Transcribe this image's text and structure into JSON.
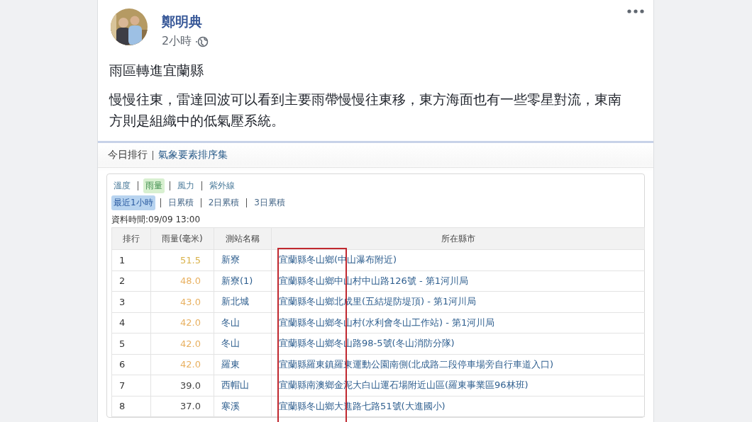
{
  "post": {
    "author": "鄭明典",
    "time": "2小時",
    "title": "雨區轉進宜蘭縣",
    "body": "慢慢往東，雷達回波可以看到主要雨帶慢慢往東移，東方海面也有一些零星對流，東南方則是組織中的低氣壓系統。"
  },
  "embed": {
    "header": [
      "今日排行",
      "氣象要素排序集"
    ],
    "tabs": [
      {
        "label": "溫度",
        "selected": false
      },
      {
        "label": "雨量",
        "selected": true
      },
      {
        "label": "風力",
        "selected": false
      },
      {
        "label": "紫外線",
        "selected": false
      }
    ],
    "periods": [
      {
        "label": "最近1小時",
        "selected": true
      },
      {
        "label": "日累積",
        "selected": false
      },
      {
        "label": "2日累積",
        "selected": false
      },
      {
        "label": "3日累積",
        "selected": false
      }
    ],
    "data_time": "資料時間:09/09 13:00",
    "table": {
      "highlight_box": true,
      "columns": [
        "排行",
        "雨量(毫米)",
        "測站名稱",
        "所在縣市"
      ],
      "rows": [
        {
          "rank": "1",
          "rain": "51.5",
          "color": "#d9b24a",
          "station": "新寮",
          "location": "宜蘭縣冬山鄉(中山瀑布附近)"
        },
        {
          "rank": "2",
          "rain": "48.0",
          "color": "#e8b060",
          "station": "新寮(1)",
          "location": "宜蘭縣冬山鄉中山村中山路126號 - 第1河川局"
        },
        {
          "rank": "3",
          "rain": "43.0",
          "color": "#e8b060",
          "station": "新北城",
          "location": "宜蘭縣冬山鄉北成里(五結堤防堤頂) - 第1河川局"
        },
        {
          "rank": "4",
          "rain": "42.0",
          "color": "#e8b060",
          "station": "冬山",
          "location": "宜蘭縣冬山鄉冬山村(水利會冬山工作站) - 第1河川局"
        },
        {
          "rank": "5",
          "rain": "42.0",
          "color": "#e8b060",
          "station": "冬山",
          "location": "宜蘭縣冬山鄉冬山路98-5號(冬山消防分隊)"
        },
        {
          "rank": "6",
          "rain": "42.0",
          "color": "#e8b060",
          "station": "羅東",
          "location": "宜蘭縣羅東鎮羅東運動公園南側(北成路二段停車場旁自行車道入口)"
        },
        {
          "rank": "7",
          "rain": "39.0",
          "color": "#444444",
          "station": "西帽山",
          "location": "宜蘭縣南澳鄉金泥大白山運石場附近山區(羅東事業區96林班)"
        },
        {
          "rank": "8",
          "rain": "37.0",
          "color": "#444444",
          "station": "寒溪",
          "location": "宜蘭縣冬山鄉大進路七路51號(大進國小)"
        }
      ]
    }
  }
}
